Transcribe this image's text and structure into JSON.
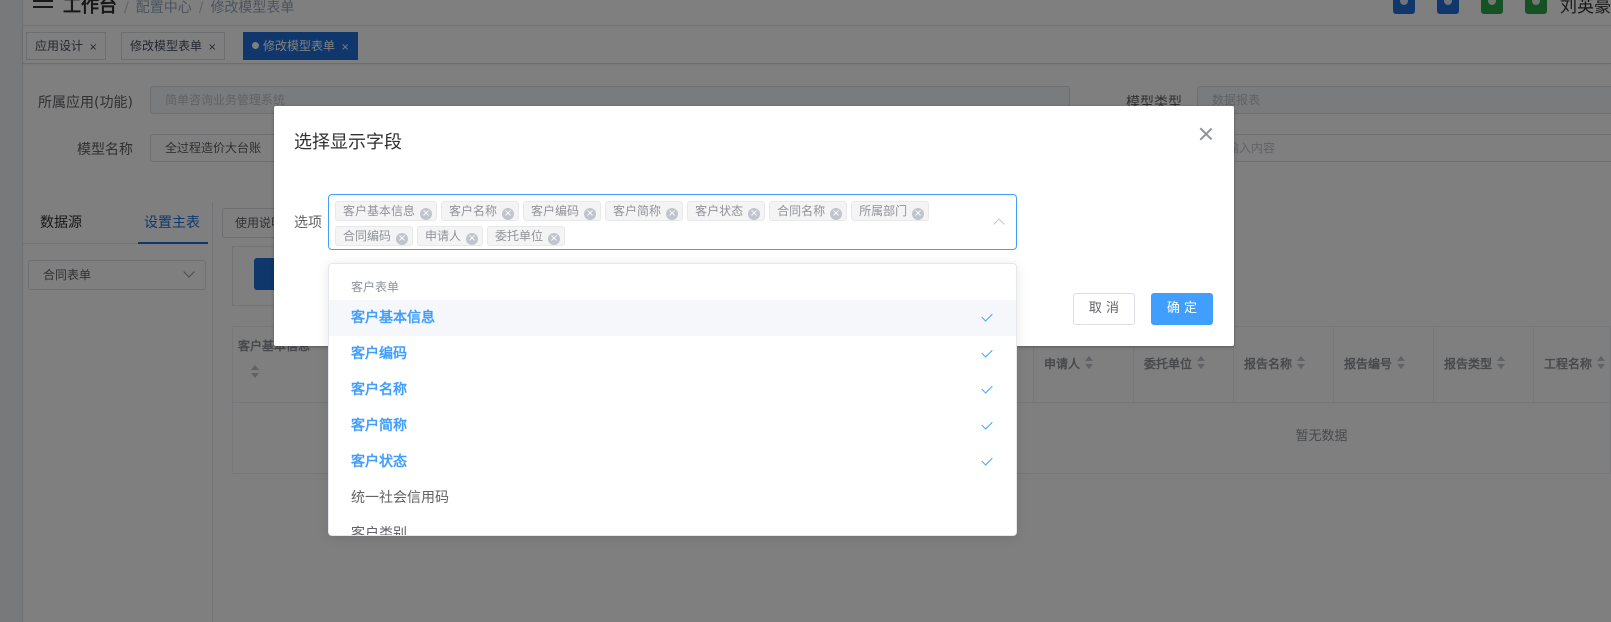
{
  "header": {
    "breadcrumb": [
      "工作台",
      "配置中心",
      "修改模型表单"
    ],
    "separator": "/",
    "username": "刘英豪",
    "icon_colors": [
      "#1e6fd9",
      "#1e6fd9",
      "#2aa345",
      "#2aa345"
    ]
  },
  "tabs": [
    {
      "label": "应用设计",
      "close": "×"
    },
    {
      "label": "修改模型表单",
      "close": "×"
    },
    {
      "label": "修改模型表单",
      "close": "×"
    }
  ],
  "form": {
    "app_label": "所属应用(功能)",
    "app_value": "简单咨询业务管理系统",
    "type_label": "模型类型",
    "type_value": "数据报表",
    "name_label": "模型名称",
    "name_value": "全过程造价大台账",
    "right_placeholder": "请输入内容"
  },
  "left_tabs": [
    "数据源",
    "设置主表"
  ],
  "left_select": "合同表单",
  "use_button": "使用说明",
  "table": {
    "first_column": "客户基本信息",
    "columns": [
      "申请人",
      "委托单位",
      "报告名称",
      "报告编号",
      "报告类型",
      "工程名称"
    ],
    "empty_text": "暂无数据"
  },
  "dialog": {
    "title": "选择显示字段",
    "option_label": "选项",
    "selected_tags": [
      "客户基本信息",
      "客户名称",
      "客户编码",
      "客户简称",
      "客户状态",
      "合同名称",
      "所属部门",
      "合同编码",
      "申请人",
      "委托单位"
    ],
    "cancel_label": "取 消",
    "confirm_label": "确 定"
  },
  "dropdown": {
    "group_title": "客户表单",
    "options": [
      {
        "label": "客户基本信息",
        "selected": true
      },
      {
        "label": "客户编码",
        "selected": true
      },
      {
        "label": "客户名称",
        "selected": true
      },
      {
        "label": "客户简称",
        "selected": true
      },
      {
        "label": "客户状态",
        "selected": true
      },
      {
        "label": "统一社会信用码",
        "selected": false
      },
      {
        "label": "客户类别",
        "selected": false
      }
    ]
  }
}
